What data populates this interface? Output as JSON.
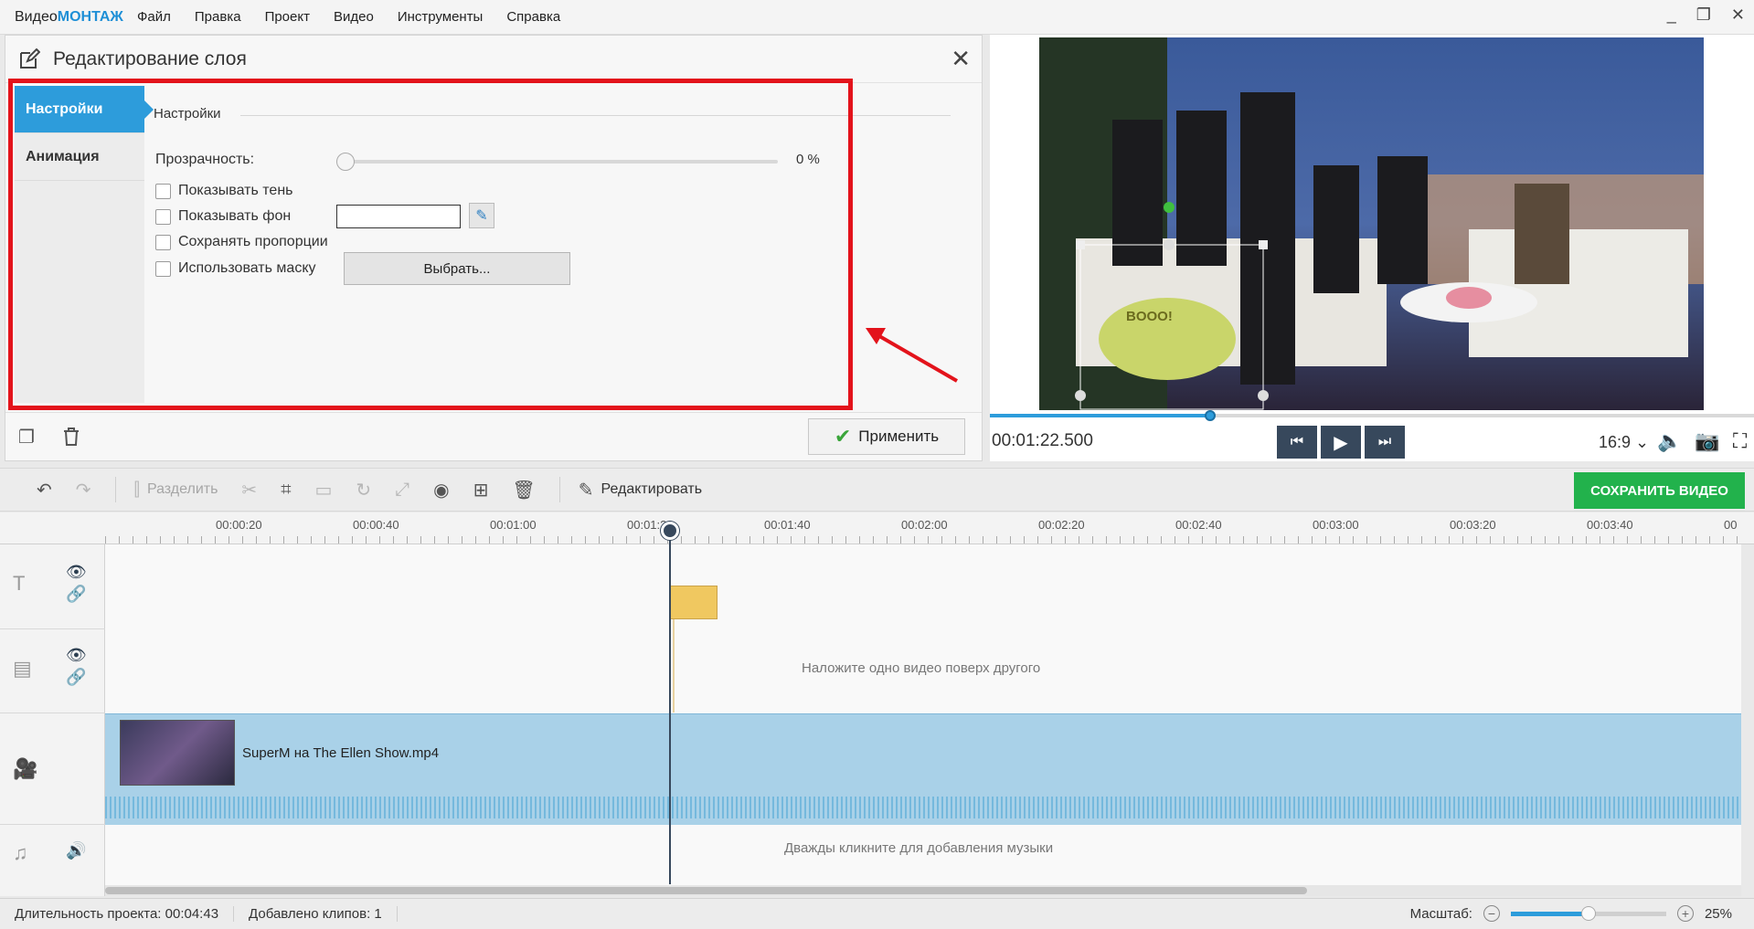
{
  "app": {
    "logo_prefix": "Видео",
    "logo_suffix": "МОНТАЖ"
  },
  "menu": [
    "Файл",
    "Правка",
    "Проект",
    "Видео",
    "Инструменты",
    "Справка"
  ],
  "window_controls": {
    "minimize": "_",
    "maximize": "❐",
    "close": "✕"
  },
  "layer_panel": {
    "title": "Редактирование слоя",
    "tabs": [
      {
        "label": "Настройки",
        "active": true
      },
      {
        "label": "Анимация",
        "active": false
      }
    ],
    "section_title": "Настройки",
    "opacity_label": "Прозрачность:",
    "opacity_value": "0 %",
    "opacity_level": 0,
    "show_shadow": "Показывать тень",
    "show_background": "Показывать фон",
    "keep_proportions": "Сохранять пропорции",
    "use_mask": "Использовать маску",
    "choose_button": "Выбрать...",
    "apply_button": "Применить"
  },
  "preview": {
    "timecode": "00:01:22.500",
    "aspect": "16:9",
    "progress": 0.29
  },
  "toolbar": {
    "split": "Разделить",
    "edit": "Редактировать",
    "save_video": "СОХРАНИТЬ ВИДЕО"
  },
  "ruler": [
    "00:00:20",
    "00:00:40",
    "00:01:00",
    "00:01:20",
    "00:01:40",
    "00:02:00",
    "00:02:20",
    "00:02:40",
    "00:03:00",
    "00:03:20",
    "00:03:40",
    "00"
  ],
  "timeline": {
    "overlay_hint": "Наложите одно видео поверх другого",
    "video_clip": "SuperM на The Ellen Show.mp4",
    "music_hint": "Дважды кликните для добавления музыки"
  },
  "status": {
    "duration": "Длительность проекта:  00:04:43",
    "clips": "Добавлено клипов: 1",
    "zoom_label": "Масштаб:",
    "zoom_value": "25%",
    "zoom_level": 0.5
  },
  "colors": {
    "accent": "#2d9cdb",
    "save": "#22b24c",
    "annotation": "#e3131b"
  }
}
